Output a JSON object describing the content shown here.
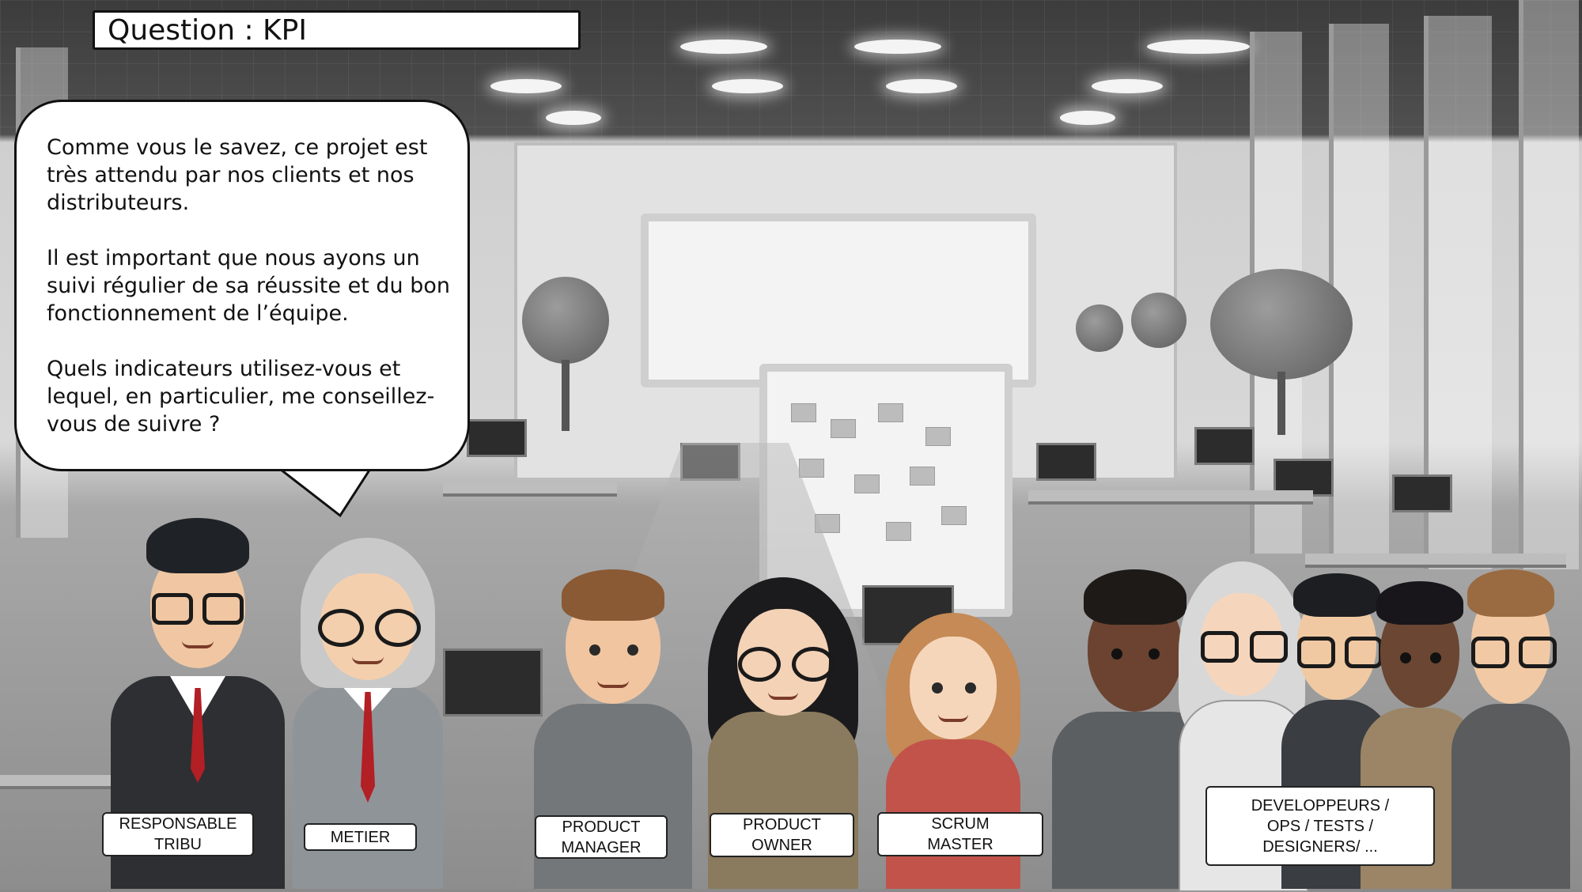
{
  "title": "Question : KPI",
  "speech_bubble": {
    "paragraphs": [
      "Comme vous le savez, ce projet est très attendu par nos clients et nos distributeurs.",
      "Il est important que nous ayons un suivi régulier de sa réussite et du bon fonctionnement de l’équipe.",
      "Quels indicateurs utilisez-vous et lequel, en particulier, me conseillez-vous de suivre ?"
    ]
  },
  "roles": [
    {
      "id": "responsable-tribu",
      "label": "RESPONSABLE\nTRIBU"
    },
    {
      "id": "metier",
      "label": "METIER"
    },
    {
      "id": "product-manager",
      "label": "PRODUCT\nMANAGER"
    },
    {
      "id": "product-owner",
      "label": "PRODUCT\nOWNER"
    },
    {
      "id": "scrum-master",
      "label": "SCRUM\nMASTER"
    },
    {
      "id": "developpeurs",
      "label": "DEVELOPPEURS /\nOPS / TESTS /\nDESIGNERS/ ..."
    }
  ],
  "colors": {
    "tie_red": "#b21f24",
    "bubble_fill": "#ffffff",
    "outline": "#111111"
  },
  "icons": {
    "background": "office-scene-illustration",
    "characters": "team-members-illustration"
  }
}
